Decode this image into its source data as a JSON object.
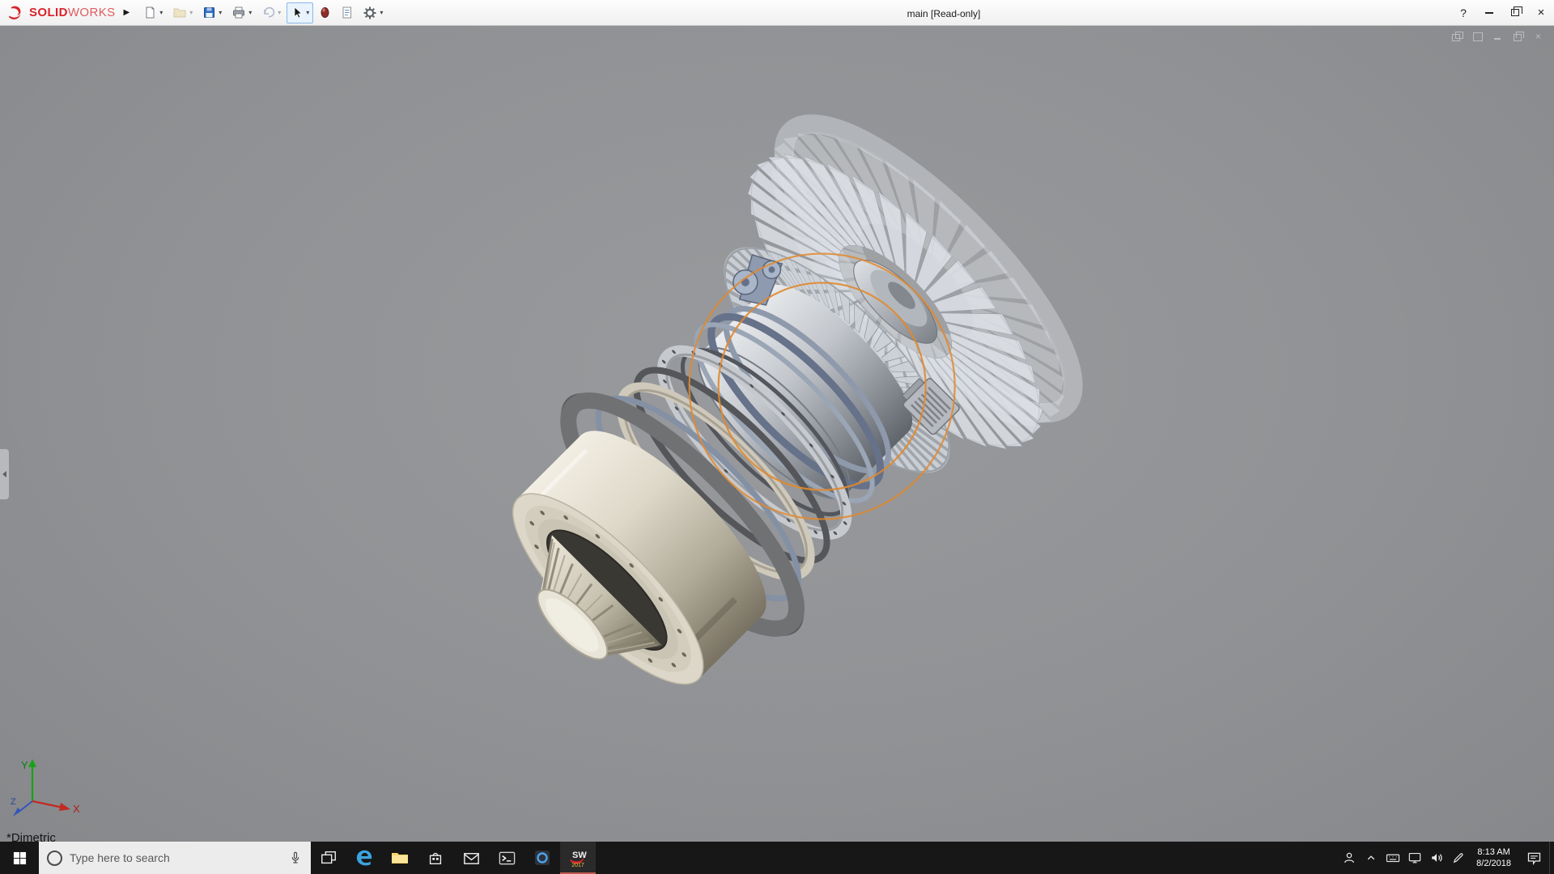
{
  "titlebar": {
    "brand_bold": "SOLID",
    "brand_light": "WORKS",
    "flyout_arrow": "▶",
    "caret": "▾",
    "title": "main [Read-only]",
    "help_label": "?",
    "close_glyph": "×",
    "toolbar_icons": [
      "new-document",
      "open",
      "save",
      "print",
      "undo",
      "select",
      "appearances",
      "file-properties",
      "options"
    ]
  },
  "viewport": {
    "orientation_label": "*Dimetric",
    "triad": {
      "x": "X",
      "y": "Y",
      "z": "Z"
    },
    "background_color": "#8f9194",
    "sketch_accent": "#e0882e"
  },
  "taskbar": {
    "search_placeholder": "Type here to search",
    "solidworks_logo": "SW",
    "solidworks_year": "2017",
    "clock_time": "8:13 AM",
    "clock_date": "8/2/2018"
  },
  "colors": {
    "brand_red": "#d8232a",
    "taskbar_background": "#171717",
    "save_blue": "#2f6fc4"
  }
}
